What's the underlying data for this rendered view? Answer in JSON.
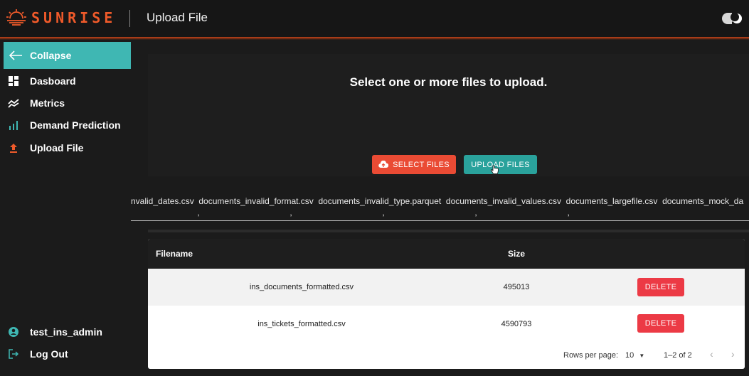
{
  "header": {
    "brand": "SUNRISE",
    "title": "Upload File",
    "theme_toggle_icon": "theme-toggle-icon"
  },
  "colors": {
    "brand": "#ef5a2a",
    "accent": "#3fb7b3",
    "select_button": "#ea4b34",
    "upload_button": "#2aa29c",
    "delete_button": "#ec3a45"
  },
  "sidebar": {
    "collapse_label": "Collapse",
    "items": [
      {
        "label": "Dasboard",
        "icon": "dashboard-icon"
      },
      {
        "label": "Metrics",
        "icon": "metrics-icon"
      },
      {
        "label": "Demand Prediction",
        "icon": "bar-chart-icon"
      },
      {
        "label": "Upload File",
        "icon": "upload-icon"
      }
    ],
    "user": {
      "label": "test_ins_admin",
      "icon": "user-icon"
    },
    "logout": {
      "label": "Log Out",
      "icon": "logout-icon"
    }
  },
  "upload": {
    "heading": "Select one or more files to upload.",
    "select_label": "SELECT FILES",
    "upload_label": "UPLOAD FILES",
    "file_names": "nvalid_dates.csv  documents_invalid_format.csv  documents_invalid_type.parquet  documents_invalid_values.csv  documents_largefile.csv  documents_mock_da"
  },
  "table": {
    "headers": {
      "filename": "Filename",
      "size": "Size"
    },
    "rows": [
      {
        "filename": "ins_documents_formatted.csv",
        "size": "495013",
        "action": "DELETE"
      },
      {
        "filename": "ins_tickets_formatted.csv",
        "size": "4590793",
        "action": "DELETE"
      }
    ],
    "pagination": {
      "rows_per_page_label": "Rows per page:",
      "rows_per_page_value": "10",
      "range": "1–2 of 2"
    }
  }
}
